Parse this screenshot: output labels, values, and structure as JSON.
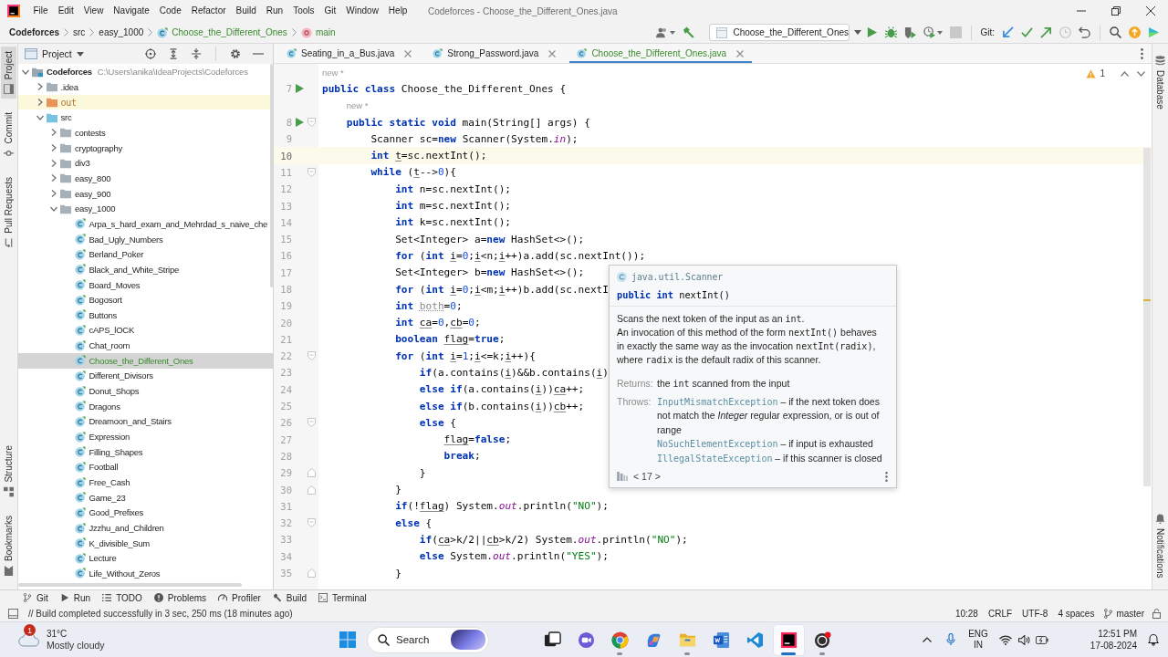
{
  "menu_bar": {
    "menus": [
      "File",
      "Edit",
      "View",
      "Navigate",
      "Code",
      "Refactor",
      "Build",
      "Run",
      "Tools",
      "Git",
      "Window",
      "Help"
    ],
    "title": "Codeforces - Choose_the_Different_Ones.java"
  },
  "nav_bar": {
    "breadcrumbs": [
      {
        "kind": "project",
        "label": "Codeforces",
        "added": false
      },
      {
        "kind": "folder",
        "label": "src",
        "added": false
      },
      {
        "kind": "folder",
        "label": "easy_1000",
        "added": false
      },
      {
        "kind": "class",
        "label": "Choose_the_Different_Ones",
        "added": true
      },
      {
        "kind": "method",
        "label": "main",
        "added": true
      }
    ],
    "run_config": "Choose_the_Different_Ones",
    "git_label": "Git:"
  },
  "left_strip": {
    "top": [
      {
        "kind": "project",
        "label": "Project",
        "selected": true
      },
      {
        "kind": "commit",
        "label": "Commit",
        "selected": false
      },
      {
        "kind": "pull-requests",
        "label": "Pull Requests",
        "selected": false
      }
    ],
    "bottom": [
      {
        "kind": "structure",
        "label": "Structure",
        "selected": false
      },
      {
        "kind": "bookmarks",
        "label": "Bookmarks",
        "selected": false
      }
    ]
  },
  "project_panel": {
    "title": "Project",
    "tree": [
      {
        "kind": "module",
        "label": "Codeforces",
        "path": "C:\\Users\\anika\\IdeaProjects\\Codeforces",
        "expanded": true,
        "selected": false,
        "children": [
          {
            "kind": "folder",
            "label": ".idea",
            "expanded": false,
            "selected": false
          },
          {
            "kind": "excluded-folder",
            "label": "out",
            "expanded": false,
            "selected": false
          },
          {
            "kind": "source-folder",
            "label": "src",
            "expanded": true,
            "selected": false,
            "children": [
              {
                "kind": "folder",
                "label": "contests",
                "expanded": false,
                "selected": false
              },
              {
                "kind": "folder",
                "label": "cryptography",
                "expanded": false,
                "selected": false
              },
              {
                "kind": "folder",
                "label": "div3",
                "expanded": false,
                "selected": false
              },
              {
                "kind": "folder",
                "label": "easy_800",
                "expanded": false,
                "selected": false
              },
              {
                "kind": "folder",
                "label": "easy_900",
                "expanded": false,
                "selected": false
              },
              {
                "kind": "folder",
                "label": "easy_1000",
                "expanded": true,
                "selected": false,
                "children": [
                  {
                    "kind": "class",
                    "label": "Arpa_s_hard_exam_and_Mehrdad_s_naive_che",
                    "selected": false,
                    "added": false
                  },
                  {
                    "kind": "class",
                    "label": "Bad_Ugly_Numbers",
                    "selected": false,
                    "added": false
                  },
                  {
                    "kind": "class",
                    "label": "Berland_Poker",
                    "selected": false,
                    "added": false
                  },
                  {
                    "kind": "class",
                    "label": "Black_and_White_Stripe",
                    "selected": false,
                    "added": false
                  },
                  {
                    "kind": "class",
                    "label": "Board_Moves",
                    "selected": false,
                    "added": false
                  },
                  {
                    "kind": "class",
                    "label": "Bogosort",
                    "selected": false,
                    "added": false
                  },
                  {
                    "kind": "class",
                    "label": "Buttons",
                    "selected": false,
                    "added": false
                  },
                  {
                    "kind": "class",
                    "label": "cAPS_lOCK",
                    "selected": false,
                    "added": false
                  },
                  {
                    "kind": "class",
                    "label": "Chat_room",
                    "selected": false,
                    "added": false
                  },
                  {
                    "kind": "class",
                    "label": "Choose_the_Different_Ones",
                    "selected": true,
                    "added": true
                  },
                  {
                    "kind": "class",
                    "label": "Different_Divisors",
                    "selected": false,
                    "added": false
                  },
                  {
                    "kind": "class",
                    "label": "Donut_Shops",
                    "selected": false,
                    "added": false
                  },
                  {
                    "kind": "class",
                    "label": "Dragons",
                    "selected": false,
                    "added": false
                  },
                  {
                    "kind": "class",
                    "label": "Dreamoon_and_Stairs",
                    "selected": false,
                    "added": false
                  },
                  {
                    "kind": "class",
                    "label": "Expression",
                    "selected": false,
                    "added": false
                  },
                  {
                    "kind": "class",
                    "label": "Filling_Shapes",
                    "selected": false,
                    "added": false
                  },
                  {
                    "kind": "class",
                    "label": "Football",
                    "selected": false,
                    "added": false
                  },
                  {
                    "kind": "class",
                    "label": "Free_Cash",
                    "selected": false,
                    "added": false
                  },
                  {
                    "kind": "class",
                    "label": "Game_23",
                    "selected": false,
                    "added": false
                  },
                  {
                    "kind": "class",
                    "label": "Good_Prefixes",
                    "selected": false,
                    "added": false
                  },
                  {
                    "kind": "class",
                    "label": "Jzzhu_and_Children",
                    "selected": false,
                    "added": false
                  },
                  {
                    "kind": "class",
                    "label": "K_divisible_Sum",
                    "selected": false,
                    "added": false
                  },
                  {
                    "kind": "class",
                    "label": "Lecture",
                    "selected": false,
                    "added": false
                  },
                  {
                    "kind": "class",
                    "label": "Life_Without_Zeros",
                    "selected": false,
                    "added": false
                  }
                ]
              }
            ]
          }
        ]
      }
    ]
  },
  "editor_tabs": [
    {
      "label": "Seating_in_a_Bus.java",
      "selected": false,
      "added": false
    },
    {
      "label": "Strong_Password.java",
      "selected": false,
      "added": false
    },
    {
      "label": "Choose_the_Different_Ones.java",
      "selected": true,
      "added": true
    }
  ],
  "editor": {
    "problems": "1",
    "lines": [
      {
        "kind": "hint",
        "text": "new *"
      },
      {
        "kind": "code",
        "number": "7",
        "run": true,
        "current": false,
        "fold_start": false,
        "fold_end": false,
        "tokens": [
          {
            "kind": "keyword",
            "text": "public class "
          },
          {
            "kind": "plain",
            "text": "Choose_the_Different_Ones {"
          }
        ]
      },
      {
        "kind": "hint",
        "text": "    new *"
      },
      {
        "kind": "code",
        "number": "8",
        "run": true,
        "current": false,
        "fold_start": true,
        "fold_end": false,
        "tokens": [
          {
            "kind": "keyword",
            "text": "    public static void "
          },
          {
            "kind": "plain",
            "text": "main(String[] args) {"
          }
        ]
      },
      {
        "kind": "code",
        "number": "9",
        "run": false,
        "current": false,
        "fold_start": false,
        "fold_end": false,
        "tokens": [
          {
            "kind": "plain",
            "text": "        Scanner sc="
          },
          {
            "kind": "keyword",
            "text": "new"
          },
          {
            "kind": "plain",
            "text": " Scanner(System."
          },
          {
            "kind": "field",
            "text": "in"
          },
          {
            "kind": "plain",
            "text": ");"
          }
        ]
      },
      {
        "kind": "code",
        "number": "10",
        "run": false,
        "current": true,
        "fold_start": false,
        "fold_end": false,
        "tokens": [
          {
            "kind": "keyword",
            "text": "        int "
          },
          {
            "kind": "reassigned",
            "text": "t"
          },
          {
            "kind": "plain",
            "text": "=sc.nextInt();"
          }
        ]
      },
      {
        "kind": "code",
        "number": "11",
        "run": false,
        "current": false,
        "fold_start": true,
        "fold_end": false,
        "tokens": [
          {
            "kind": "keyword",
            "text": "        while"
          },
          {
            "kind": "plain",
            "text": " ("
          },
          {
            "kind": "reassigned",
            "text": "t"
          },
          {
            "kind": "plain",
            "text": "-->"
          },
          {
            "kind": "number",
            "text": "0"
          },
          {
            "kind": "plain",
            "text": "){"
          }
        ]
      },
      {
        "kind": "code",
        "number": "12",
        "run": false,
        "current": false,
        "fold_start": false,
        "fold_end": false,
        "tokens": [
          {
            "kind": "keyword",
            "text": "            int "
          },
          {
            "kind": "plain",
            "text": "n=sc.nextInt();"
          }
        ]
      },
      {
        "kind": "code",
        "number": "13",
        "run": false,
        "current": false,
        "fold_start": false,
        "fold_end": false,
        "tokens": [
          {
            "kind": "keyword",
            "text": "            int "
          },
          {
            "kind": "plain",
            "text": "m=sc.nextInt();"
          }
        ]
      },
      {
        "kind": "code",
        "number": "14",
        "run": false,
        "current": false,
        "fold_start": false,
        "fold_end": false,
        "tokens": [
          {
            "kind": "keyword",
            "text": "            int "
          },
          {
            "kind": "plain",
            "text": "k=sc.nextInt();"
          }
        ]
      },
      {
        "kind": "code",
        "number": "15",
        "run": false,
        "current": false,
        "fold_start": false,
        "fold_end": false,
        "tokens": [
          {
            "kind": "plain",
            "text": "            Set<Integer> a="
          },
          {
            "kind": "keyword",
            "text": "new"
          },
          {
            "kind": "plain",
            "text": " HashSet<>();"
          }
        ]
      },
      {
        "kind": "code",
        "number": "16",
        "run": false,
        "current": false,
        "fold_start": false,
        "fold_end": false,
        "tokens": [
          {
            "kind": "keyword",
            "text": "            for"
          },
          {
            "kind": "plain",
            "text": " ("
          },
          {
            "kind": "keyword",
            "text": "int "
          },
          {
            "kind": "reassigned",
            "text": "i"
          },
          {
            "kind": "plain",
            "text": "="
          },
          {
            "kind": "number",
            "text": "0"
          },
          {
            "kind": "plain",
            "text": ";"
          },
          {
            "kind": "reassigned",
            "text": "i"
          },
          {
            "kind": "plain",
            "text": "<n;"
          },
          {
            "kind": "reassigned",
            "text": "i"
          },
          {
            "kind": "plain",
            "text": "++)a.add(sc.nextInt());"
          }
        ]
      },
      {
        "kind": "code",
        "number": "17",
        "run": false,
        "current": false,
        "fold_start": false,
        "fold_end": false,
        "tokens": [
          {
            "kind": "plain",
            "text": "            Set<Integer> b="
          },
          {
            "kind": "keyword",
            "text": "new"
          },
          {
            "kind": "plain",
            "text": " HashSet<>();"
          }
        ]
      },
      {
        "kind": "code",
        "number": "18",
        "run": false,
        "current": false,
        "fold_start": false,
        "fold_end": false,
        "tokens": [
          {
            "kind": "keyword",
            "text": "            for"
          },
          {
            "kind": "plain",
            "text": " ("
          },
          {
            "kind": "keyword",
            "text": "int "
          },
          {
            "kind": "reassigned",
            "text": "i"
          },
          {
            "kind": "plain",
            "text": "="
          },
          {
            "kind": "number",
            "text": "0"
          },
          {
            "kind": "plain",
            "text": ";"
          },
          {
            "kind": "reassigned",
            "text": "i"
          },
          {
            "kind": "plain",
            "text": "<m;"
          },
          {
            "kind": "reassigned",
            "text": "i"
          },
          {
            "kind": "plain",
            "text": "++)b.add(sc.nextI"
          }
        ]
      },
      {
        "kind": "code",
        "number": "19",
        "run": false,
        "current": false,
        "fold_start": false,
        "fold_end": false,
        "tokens": [
          {
            "kind": "keyword",
            "text": "            int "
          },
          {
            "kind": "unused",
            "text": "both"
          },
          {
            "kind": "plain",
            "text": "="
          },
          {
            "kind": "number",
            "text": "0"
          },
          {
            "kind": "plain",
            "text": ";"
          }
        ]
      },
      {
        "kind": "code",
        "number": "20",
        "run": false,
        "current": false,
        "fold_start": false,
        "fold_end": false,
        "tokens": [
          {
            "kind": "keyword",
            "text": "            int "
          },
          {
            "kind": "reassigned",
            "text": "ca"
          },
          {
            "kind": "plain",
            "text": "="
          },
          {
            "kind": "number",
            "text": "0"
          },
          {
            "kind": "plain",
            "text": ","
          },
          {
            "kind": "reassigned",
            "text": "cb"
          },
          {
            "kind": "plain",
            "text": "="
          },
          {
            "kind": "number",
            "text": "0"
          },
          {
            "kind": "plain",
            "text": ";"
          }
        ]
      },
      {
        "kind": "code",
        "number": "21",
        "run": false,
        "current": false,
        "fold_start": false,
        "fold_end": false,
        "tokens": [
          {
            "kind": "keyword",
            "text": "            boolean "
          },
          {
            "kind": "reassigned",
            "text": "flag"
          },
          {
            "kind": "plain",
            "text": "="
          },
          {
            "kind": "keyword",
            "text": "true"
          },
          {
            "kind": "plain",
            "text": ";"
          }
        ]
      },
      {
        "kind": "code",
        "number": "22",
        "run": false,
        "current": false,
        "fold_start": true,
        "fold_end": false,
        "tokens": [
          {
            "kind": "keyword",
            "text": "            for"
          },
          {
            "kind": "plain",
            "text": " ("
          },
          {
            "kind": "keyword",
            "text": "int "
          },
          {
            "kind": "reassigned",
            "text": "i"
          },
          {
            "kind": "plain",
            "text": "="
          },
          {
            "kind": "number",
            "text": "1"
          },
          {
            "kind": "plain",
            "text": ";"
          },
          {
            "kind": "reassigned",
            "text": "i"
          },
          {
            "kind": "plain",
            "text": "<=k;"
          },
          {
            "kind": "reassigned",
            "text": "i"
          },
          {
            "kind": "plain",
            "text": "++){"
          }
        ]
      },
      {
        "kind": "code",
        "number": "23",
        "run": false,
        "current": false,
        "fold_start": false,
        "fold_end": false,
        "tokens": [
          {
            "kind": "keyword",
            "text": "                if"
          },
          {
            "kind": "plain",
            "text": "(a.contains("
          },
          {
            "kind": "reassigned",
            "text": "i"
          },
          {
            "kind": "plain",
            "text": ")&&b.contains("
          },
          {
            "kind": "reassigned",
            "text": "i"
          },
          {
            "kind": "plain",
            "text": ")"
          }
        ]
      },
      {
        "kind": "code",
        "number": "24",
        "run": false,
        "current": false,
        "fold_start": false,
        "fold_end": false,
        "tokens": [
          {
            "kind": "keyword",
            "text": "                else if"
          },
          {
            "kind": "plain",
            "text": "(a.contains("
          },
          {
            "kind": "reassigned",
            "text": "i"
          },
          {
            "kind": "plain",
            "text": "))"
          },
          {
            "kind": "reassigned",
            "text": "ca"
          },
          {
            "kind": "plain",
            "text": "++;"
          }
        ]
      },
      {
        "kind": "code",
        "number": "25",
        "run": false,
        "current": false,
        "fold_start": false,
        "fold_end": false,
        "tokens": [
          {
            "kind": "keyword",
            "text": "                else if"
          },
          {
            "kind": "plain",
            "text": "(b.contains("
          },
          {
            "kind": "reassigned",
            "text": "i"
          },
          {
            "kind": "plain",
            "text": "))"
          },
          {
            "kind": "reassigned",
            "text": "cb"
          },
          {
            "kind": "plain",
            "text": "++;"
          }
        ]
      },
      {
        "kind": "code",
        "number": "26",
        "run": false,
        "current": false,
        "fold_start": true,
        "fold_end": false,
        "tokens": [
          {
            "kind": "keyword",
            "text": "                else"
          },
          {
            "kind": "plain",
            "text": " {"
          }
        ]
      },
      {
        "kind": "code",
        "number": "27",
        "run": false,
        "current": false,
        "fold_start": false,
        "fold_end": false,
        "tokens": [
          {
            "kind": "reassigned",
            "text": "                    flag"
          },
          {
            "kind": "plain",
            "text": "="
          },
          {
            "kind": "keyword",
            "text": "false"
          },
          {
            "kind": "plain",
            "text": ";"
          }
        ]
      },
      {
        "kind": "code",
        "number": "28",
        "run": false,
        "current": false,
        "fold_start": false,
        "fold_end": false,
        "tokens": [
          {
            "kind": "keyword",
            "text": "                    break"
          },
          {
            "kind": "plain",
            "text": ";"
          }
        ]
      },
      {
        "kind": "code",
        "number": "29",
        "run": false,
        "current": false,
        "fold_start": false,
        "fold_end": true,
        "tokens": [
          {
            "kind": "plain",
            "text": "                }"
          }
        ]
      },
      {
        "kind": "code",
        "number": "30",
        "run": false,
        "current": false,
        "fold_start": false,
        "fold_end": true,
        "tokens": [
          {
            "kind": "plain",
            "text": "            }"
          }
        ]
      },
      {
        "kind": "code",
        "number": "31",
        "run": false,
        "current": false,
        "fold_start": false,
        "fold_end": false,
        "tokens": [
          {
            "kind": "keyword",
            "text": "            if"
          },
          {
            "kind": "plain",
            "text": "(!"
          },
          {
            "kind": "reassigned",
            "text": "flag"
          },
          {
            "kind": "plain",
            "text": ") System."
          },
          {
            "kind": "field",
            "text": "out"
          },
          {
            "kind": "plain",
            "text": ".println("
          },
          {
            "kind": "string",
            "text": "\"NO\""
          },
          {
            "kind": "plain",
            "text": ");"
          }
        ]
      },
      {
        "kind": "code",
        "number": "32",
        "run": false,
        "current": false,
        "fold_start": true,
        "fold_end": false,
        "tokens": [
          {
            "kind": "keyword",
            "text": "            else"
          },
          {
            "kind": "plain",
            "text": " {"
          }
        ]
      },
      {
        "kind": "code",
        "number": "33",
        "run": false,
        "current": false,
        "fold_start": false,
        "fold_end": false,
        "tokens": [
          {
            "kind": "keyword",
            "text": "                if"
          },
          {
            "kind": "plain",
            "text": "("
          },
          {
            "kind": "reassigned",
            "text": "ca"
          },
          {
            "kind": "plain",
            "text": ">k/2||"
          },
          {
            "kind": "reassigned",
            "text": "cb"
          },
          {
            "kind": "plain",
            "text": ">k/2) System."
          },
          {
            "kind": "field",
            "text": "out"
          },
          {
            "kind": "plain",
            "text": ".println("
          },
          {
            "kind": "string",
            "text": "\"NO\""
          },
          {
            "kind": "plain",
            "text": ");"
          }
        ]
      },
      {
        "kind": "code",
        "number": "34",
        "run": false,
        "current": false,
        "fold_start": false,
        "fold_end": false,
        "tokens": [
          {
            "kind": "keyword",
            "text": "                else"
          },
          {
            "kind": "plain",
            "text": " System."
          },
          {
            "kind": "field",
            "text": "out"
          },
          {
            "kind": "plain",
            "text": ".println("
          },
          {
            "kind": "string",
            "text": "\"YES\""
          },
          {
            "kind": "plain",
            "text": ");"
          }
        ]
      },
      {
        "kind": "code",
        "number": "35",
        "run": false,
        "current": false,
        "fold_start": false,
        "fold_end": true,
        "tokens": [
          {
            "kind": "plain",
            "text": "            }"
          }
        ]
      }
    ]
  },
  "doc_popup": {
    "class_name": "java.util.Scanner",
    "signature": [
      {
        "kind": "keyword",
        "text": "public int "
      },
      {
        "kind": "plain",
        "text": "nextInt()"
      }
    ],
    "description": [
      [
        {
          "kind": "text",
          "text": "Scans the next token of the input as an "
        },
        {
          "kind": "code",
          "text": "int"
        },
        {
          "kind": "text",
          "text": "."
        }
      ],
      [
        {
          "kind": "text",
          "text": "An invocation of this method of the form "
        },
        {
          "kind": "code",
          "text": "nextInt()"
        },
        {
          "kind": "text",
          "text": " behaves in exactly the same way as the invocation "
        },
        {
          "kind": "code",
          "text": "nextInt(radix)"
        },
        {
          "kind": "text",
          "text": ", where "
        },
        {
          "kind": "code",
          "text": "radix"
        },
        {
          "kind": "text",
          "text": " is the default radix of this scanner."
        }
      ]
    ],
    "returns_label": "Returns:",
    "returns": [
      {
        "kind": "text",
        "text": "the "
      },
      {
        "kind": "code",
        "text": "int"
      },
      {
        "kind": "text",
        "text": " scanned from the input"
      }
    ],
    "throws_label": "Throws:",
    "throws": [
      {
        "exception": "InputMismatchException",
        "text": "– if the next token does not match the *Integer* regular expression, or is out of range"
      },
      {
        "exception": "NoSuchElementException",
        "text": "– if input is exhausted"
      },
      {
        "exception": "IllegalStateException",
        "text": "– if this scanner is closed"
      }
    ],
    "version": "< 17 >"
  },
  "right_strip": {
    "top": [
      {
        "kind": "database",
        "label": "Database"
      }
    ],
    "bottom": [
      {
        "kind": "notifications",
        "label": "Notifications"
      }
    ]
  },
  "tool_windows": [
    {
      "kind": "git",
      "label": "Git"
    },
    {
      "kind": "run",
      "label": "Run"
    },
    {
      "kind": "todo",
      "label": "TODO"
    },
    {
      "kind": "problems",
      "label": "Problems"
    },
    {
      "kind": "profiler",
      "label": "Profiler"
    },
    {
      "kind": "build",
      "label": "Build"
    },
    {
      "kind": "terminal",
      "label": "Terminal"
    }
  ],
  "status_bar": {
    "message": "// Build completed successfully in 3 sec, 250 ms (18 minutes ago)",
    "items": [
      "10:28",
      "CRLF",
      "UTF-8",
      "4 spaces"
    ],
    "branch": "master"
  },
  "taskbar": {
    "weather": {
      "badge": "1",
      "temperature": "31°C",
      "condition": "Mostly cloudy"
    },
    "search": {
      "placeholder": "Search"
    },
    "apps": [
      {
        "kind": "task-view",
        "open": false,
        "active": false
      },
      {
        "kind": "chat",
        "open": false,
        "active": false
      },
      {
        "kind": "browser",
        "open": true,
        "active": false
      },
      {
        "kind": "copilot",
        "open": false,
        "active": false
      },
      {
        "kind": "files",
        "open": true,
        "active": false
      },
      {
        "kind": "word",
        "open": false,
        "active": false
      },
      {
        "kind": "code-editor",
        "open": false,
        "active": false
      },
      {
        "kind": "ide",
        "open": true,
        "active": true
      },
      {
        "kind": "recorder",
        "open": true,
        "active": false
      }
    ],
    "tray": {
      "language": "ENG",
      "region": "IN",
      "time": "12:51 PM",
      "date": "17-08-2024"
    }
  }
}
